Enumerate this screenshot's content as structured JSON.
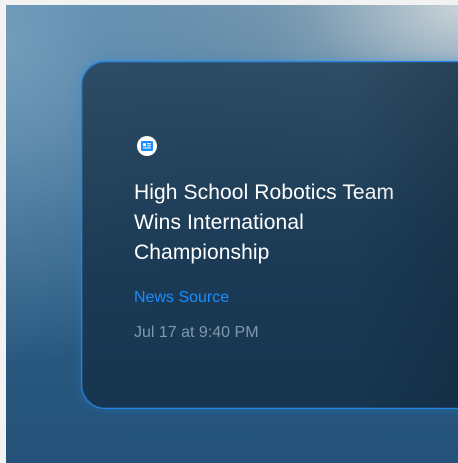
{
  "notification": {
    "app_icon": "news-icon",
    "headline": "High School Robotics Team Wins International Championship",
    "source": "News Source",
    "timestamp": "Jul 17 at 9:40 PM"
  },
  "colors": {
    "accent": "#1a8cff",
    "card_border": "#1f86e6",
    "headline_text": "#ffffff",
    "timestamp_text": "#7e98ad"
  }
}
